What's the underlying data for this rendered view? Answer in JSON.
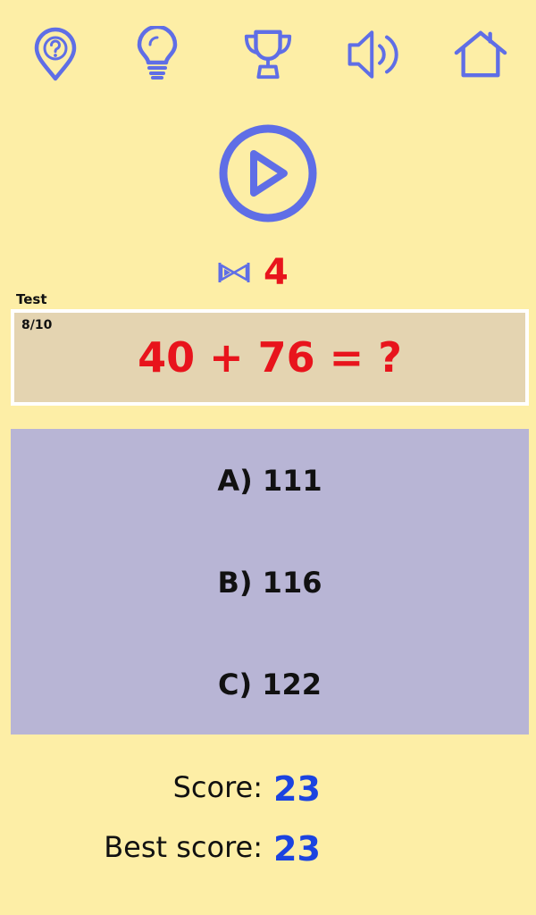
{
  "toolbar": {
    "icons": [
      "help-icon",
      "lightbulb-icon",
      "trophy-icon",
      "sound-icon",
      "home-icon"
    ]
  },
  "controls": {
    "play_icon": "play-icon"
  },
  "timer": {
    "icon": "hourglass-icon",
    "value": "4"
  },
  "quiz": {
    "mode": "Test",
    "counter": "8/10",
    "question": "40 + 76 = ?",
    "answers": [
      "A) 111",
      "B) 116",
      "C) 122"
    ]
  },
  "stats": {
    "score_label": "Score:",
    "score_value": "23",
    "best_label": "Best score:",
    "best_value": "23"
  },
  "colors": {
    "background": "#fdeea6",
    "icon": "#5f6ee6",
    "question": "#e8141c",
    "score": "#1b43e0",
    "question_panel": "#e4d4b1",
    "answers_panel": "#b8b5d5"
  }
}
